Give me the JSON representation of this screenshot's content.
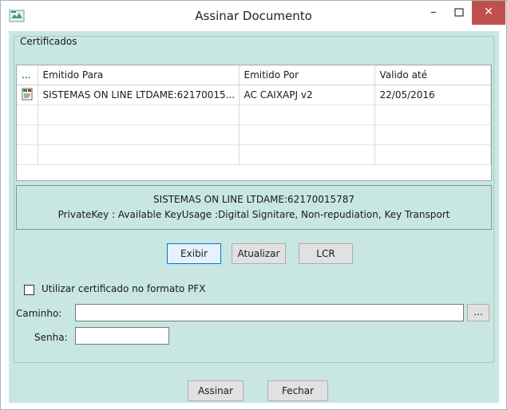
{
  "window": {
    "title": "Assinar Documento",
    "minimize": "–",
    "maximize": "□",
    "close": "✕"
  },
  "certificados": {
    "group_label": "Certificados",
    "columns": [
      "...",
      "Emitido Para",
      "Emitido Por",
      "Valido até"
    ],
    "rows": [
      {
        "emitido_para": "SISTEMAS ON LINE LTDAME:62170015...",
        "emitido_por": "AC CAIXAPJ v2",
        "valido_ate": "22/05/2016",
        "icon": "certificate-icon"
      }
    ],
    "info_line1": "SISTEMAS ON LINE LTDAME:62170015787",
    "info_line2": "PrivateKey : Available KeyUsage :Digital Signitare, Non-repudiation, Key Transport"
  },
  "buttons": {
    "exibir": "Exibir",
    "atualizar": "Atualizar",
    "lcr": "LCR",
    "browse": "...",
    "assinar": "Assinar",
    "fechar": "Fechar"
  },
  "pfx": {
    "checkbox_label": "Utilizar certificado no formato PFX",
    "checked": false
  },
  "form": {
    "caminho_label": "Caminho:",
    "caminho_value": "",
    "senha_label": "Senha:",
    "senha_value": ""
  },
  "colors": {
    "client_bg": "#c8e6e2",
    "close_button": "#c0504d",
    "focus_border": "#0078d7"
  }
}
